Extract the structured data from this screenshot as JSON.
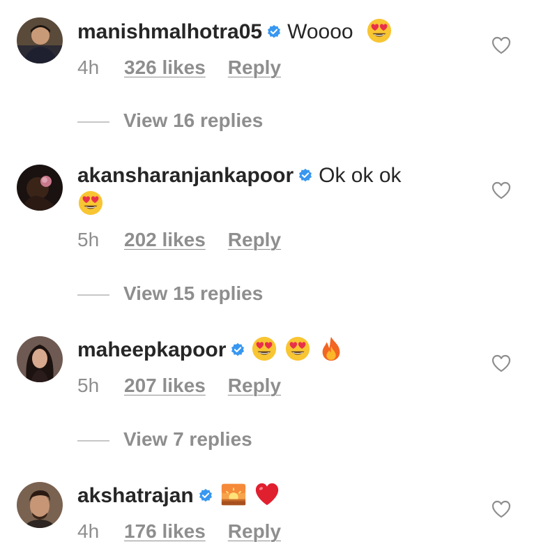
{
  "comments": [
    {
      "username": "manishmalhotra05",
      "text": "Woooo",
      "emojis": [
        "heart-eyes"
      ],
      "time": "4h",
      "likes": "326 likes",
      "reply": "Reply",
      "view_replies": "View 16 replies"
    },
    {
      "username": "akansharanjankapoor",
      "text": "Ok ok ok",
      "emojis": [
        "heart-eyes"
      ],
      "time": "5h",
      "likes": "202 likes",
      "reply": "Reply",
      "view_replies": "View 15 replies"
    },
    {
      "username": "maheepkapoor",
      "text": "",
      "emojis": [
        "heart-eyes",
        "heart-eyes",
        "fire"
      ],
      "time": "5h",
      "likes": "207 likes",
      "reply": "Reply",
      "view_replies": "View 7 replies"
    },
    {
      "username": "akshatrajan",
      "text": "",
      "emojis": [
        "sunrise",
        "red-heart"
      ],
      "time": "4h",
      "likes": "176 likes",
      "reply": "Reply"
    }
  ],
  "colors": {
    "text": "#262626",
    "muted": "#8e8e8e",
    "verified": "#3897f0"
  }
}
